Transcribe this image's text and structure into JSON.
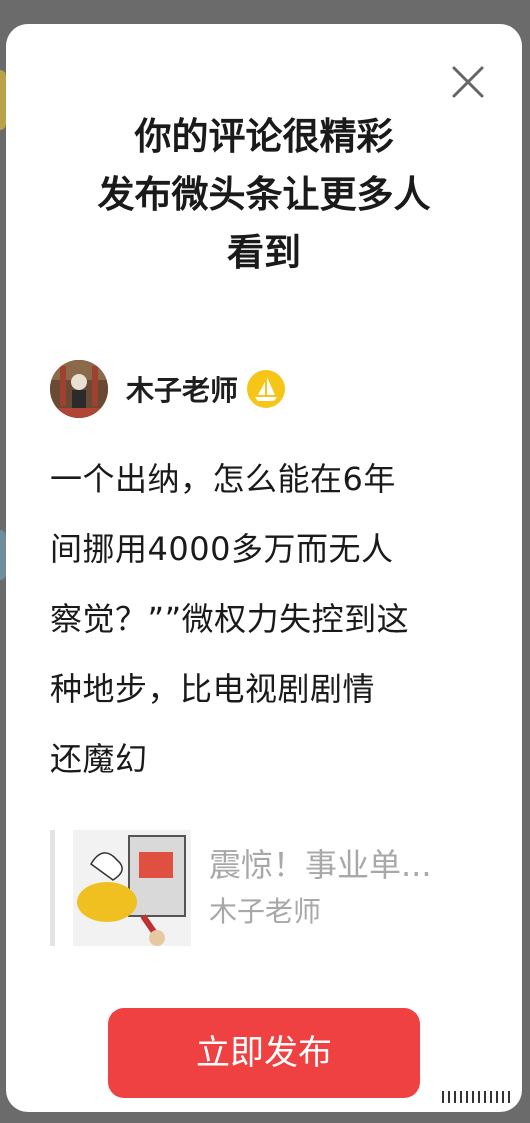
{
  "modal": {
    "title_lines": [
      "你的评论很精彩",
      "发布微头条让更多人",
      "看到"
    ],
    "close_icon": "close-icon"
  },
  "author": {
    "name": "木子老师",
    "badge_icon": "sailboat-badge-icon",
    "avatar_icon": "user-avatar"
  },
  "comment": {
    "lines": [
      "一个出纳，怎么能在6年",
      "间挪用4000多万而无人",
      "察觉？””微权力失控到这",
      "种地步，比电视剧剧情",
      "还魔幻"
    ]
  },
  "article": {
    "title": "震惊！事业单...",
    "author": "木子老师",
    "thumbnail_icon": "article-thumbnail"
  },
  "actions": {
    "publish_label": "立即发布"
  },
  "colors": {
    "accent": "#f04142",
    "muted_text": "#a8a8a8",
    "badge": "#f5c518"
  }
}
